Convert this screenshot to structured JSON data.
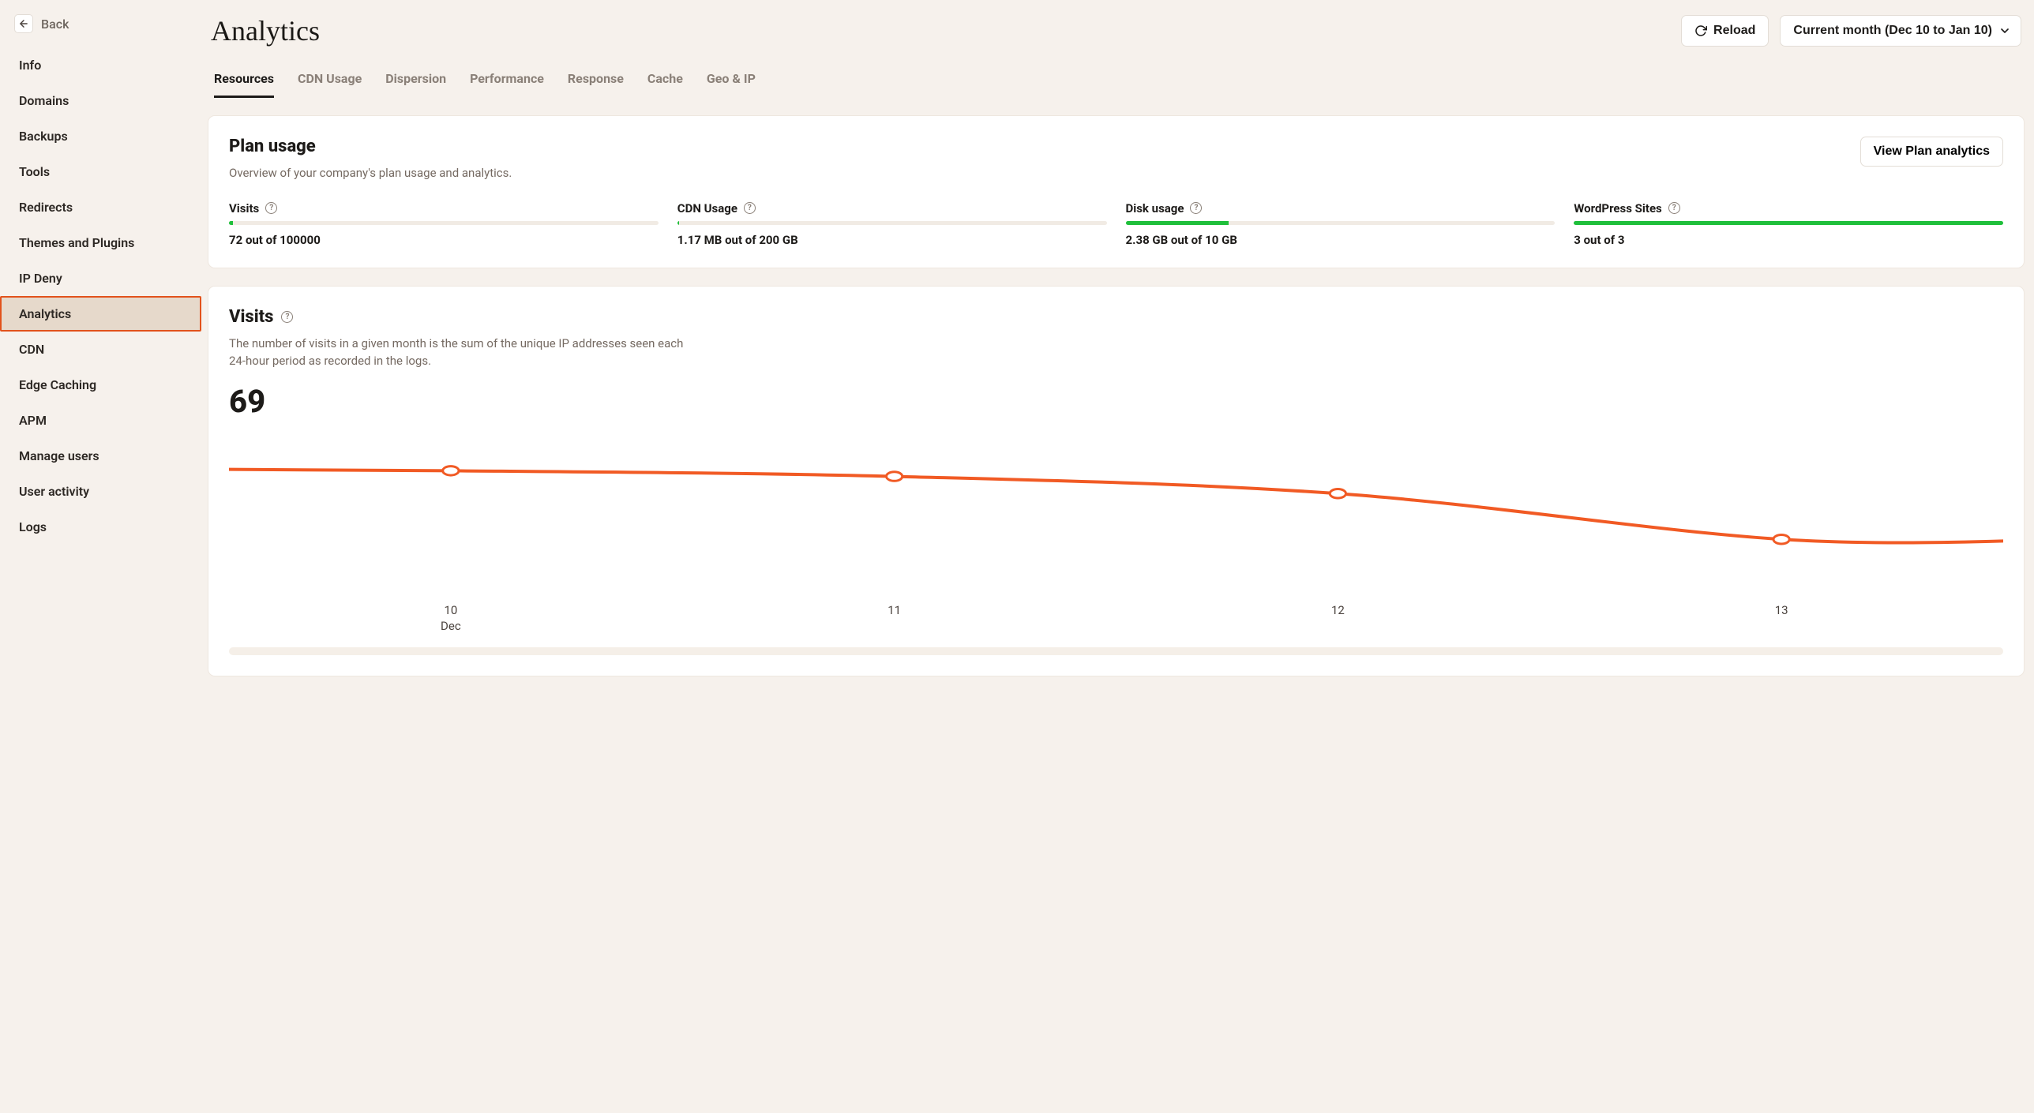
{
  "back_label": "Back",
  "sidebar": {
    "items": [
      {
        "label": "Info"
      },
      {
        "label": "Domains"
      },
      {
        "label": "Backups"
      },
      {
        "label": "Tools"
      },
      {
        "label": "Redirects"
      },
      {
        "label": "Themes and Plugins"
      },
      {
        "label": "IP Deny"
      },
      {
        "label": "Analytics",
        "active": true
      },
      {
        "label": "CDN"
      },
      {
        "label": "Edge Caching"
      },
      {
        "label": "APM"
      },
      {
        "label": "Manage users"
      },
      {
        "label": "User activity"
      },
      {
        "label": "Logs"
      }
    ]
  },
  "page_title": "Analytics",
  "header": {
    "reload_label": "Reload",
    "period_label": "Current month (Dec 10 to Jan 10)"
  },
  "tabs": [
    {
      "label": "Resources",
      "active": true
    },
    {
      "label": "CDN Usage"
    },
    {
      "label": "Dispersion"
    },
    {
      "label": "Performance"
    },
    {
      "label": "Response"
    },
    {
      "label": "Cache"
    },
    {
      "label": "Geo & IP"
    }
  ],
  "plan_usage": {
    "title": "Plan usage",
    "subtitle": "Overview of your company's plan usage and analytics.",
    "view_button": "View Plan analytics",
    "metrics": [
      {
        "label": "Visits",
        "value": "72 out of 100000",
        "pct": 1
      },
      {
        "label": "CDN Usage",
        "value": "1.17 MB out of 200 GB",
        "pct": 0.5
      },
      {
        "label": "Disk usage",
        "value": "2.38 GB out of 10 GB",
        "pct": 24
      },
      {
        "label": "WordPress Sites",
        "value": "3 out of 3",
        "pct": 100
      }
    ]
  },
  "visits": {
    "title": "Visits",
    "subtitle": "The number of visits in a given month is the sum of the unique IP addresses seen each 24-hour period as recorded in the logs.",
    "total": "69"
  },
  "chart_data": {
    "type": "line",
    "x": [
      10,
      11,
      12,
      13
    ],
    "values": [
      22,
      21,
      18,
      10
    ],
    "xlabel": "Dec",
    "ylabel": "",
    "ylim": [
      0,
      30
    ],
    "title": "Visits",
    "color": "#f15a24"
  },
  "axis": {
    "ticks": [
      "10",
      "11",
      "12",
      "13"
    ],
    "month": "Dec"
  }
}
